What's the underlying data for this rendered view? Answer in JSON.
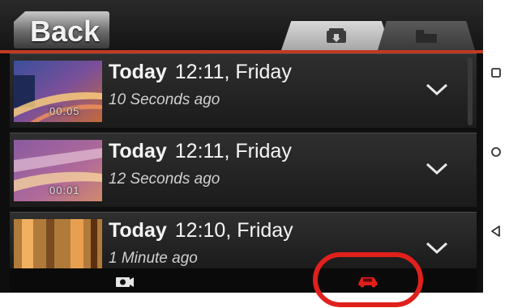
{
  "header": {
    "back_label": "Back",
    "tabs": [
      {
        "icon": "recordings-icon",
        "active": true
      },
      {
        "icon": "folder-icon",
        "active": false
      }
    ]
  },
  "recordings": [
    {
      "day": "Today",
      "time": "12:11, Friday",
      "ago": "10 Seconds ago",
      "duration": "00:05"
    },
    {
      "day": "Today",
      "time": "12:11, Friday",
      "ago": "12 Seconds ago",
      "duration": "00:01"
    },
    {
      "day": "Today",
      "time": "12:10, Friday",
      "ago": "1 Minute ago",
      "duration": ""
    }
  ],
  "bottom_bar": {
    "left_icon": "camera-icon",
    "right_icon": "car-icon",
    "right_color": "#e0201c"
  },
  "colors": {
    "accent": "#c03a22",
    "highlight_circle": "#e0201c"
  }
}
